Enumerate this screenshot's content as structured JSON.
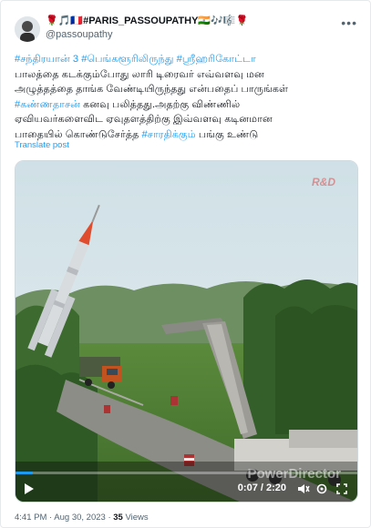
{
  "author": {
    "display_name": "🌹🎵🇫🇷#PARIS_PASSOUPATHY🇮🇳🎶🎼🌹",
    "handle": "@passoupathy"
  },
  "tweet": {
    "lines": [
      [
        {
          "t": "#சந்திரயான் 3 ",
          "h": true
        },
        {
          "t": "#பெங்களூரிலிருந்து ",
          "h": true
        },
        {
          "t": "#ஸ்ரீஹரிகோட்டா",
          "h": true
        }
      ],
      [
        {
          "t": "பாலத்தை கடக்கும்போது லாரி டிரைவர் எவ்வளவு மன",
          "h": false
        }
      ],
      [
        {
          "t": "அழுத்தத்தை தாங்க வேண்டியிருந்தது என்பதைப் பாருங்கள்",
          "h": false
        }
      ],
      [
        {
          "t": "#கண்ணதாசன்",
          "h": true
        },
        {
          "t": " கனவு பலித்தது.அதற்கு விண்ணில்",
          "h": false
        }
      ],
      [
        {
          "t": "ஏவியவர்களைவிட ஏவுதளத்திற்கு இவ்வளவு கடினமான",
          "h": false
        }
      ],
      [
        {
          "t": "பாதையில் கொண்டுசேர்த்த ",
          "h": false
        },
        {
          "t": "#சாரதிக்கும்",
          "h": true
        },
        {
          "t": " பங்கு உண்டு",
          "h": false
        }
      ]
    ],
    "translate_label": "Translate post"
  },
  "video": {
    "time": "0:07 / 2:20",
    "progress": 0.05,
    "watermark": "PowerDirector",
    "brand_mark": "R&D"
  },
  "meta": {
    "time": "4:41 PM · Aug 30, 2023 · ",
    "views_count": "35",
    "views_label": " Views"
  },
  "colors": {
    "accent": "#1d9bf0",
    "muted": "#536471",
    "text": "#0f1419"
  },
  "icons": [
    "more-icon",
    "play-icon",
    "volume-icon",
    "settings-icon",
    "fullscreen-icon"
  ]
}
